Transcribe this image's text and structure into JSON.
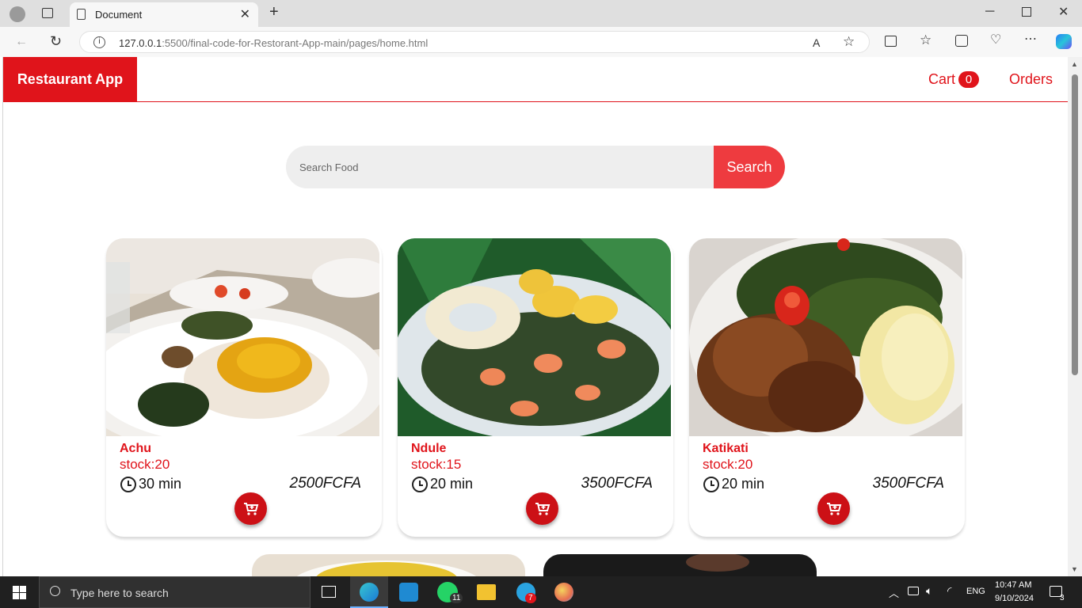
{
  "browser": {
    "tab_title": "Document",
    "url_host": "127.0.0.1",
    "url_path": ":5500/final-code-for-Restorant-App-main/pages/home.html"
  },
  "navbar": {
    "brand": "Restaurant App",
    "cart_label": "Cart",
    "cart_count": "0",
    "orders_label": "Orders"
  },
  "search": {
    "placeholder": "Search Food",
    "button": "Search"
  },
  "foods": [
    {
      "name": "Achu",
      "stock": "stock:20",
      "time": "30 min",
      "price": "2500FCFA"
    },
    {
      "name": "Ndule",
      "stock": "stock:15",
      "time": "20 min",
      "price": "3500FCFA"
    },
    {
      "name": "Katikati",
      "stock": "stock:20",
      "time": "20 min",
      "price": "3500FCFA"
    }
  ],
  "colors": {
    "accent": "#e0141b",
    "search_button": "#ee3b3f",
    "cart_button": "#cc1016"
  },
  "taskbar": {
    "search_placeholder": "Type here to search",
    "lang": "ENG",
    "time": "10:47 AM",
    "date": "9/10/2024",
    "notification_count": "3",
    "whatsapp_badge": "11",
    "telegram_badge": "7"
  }
}
